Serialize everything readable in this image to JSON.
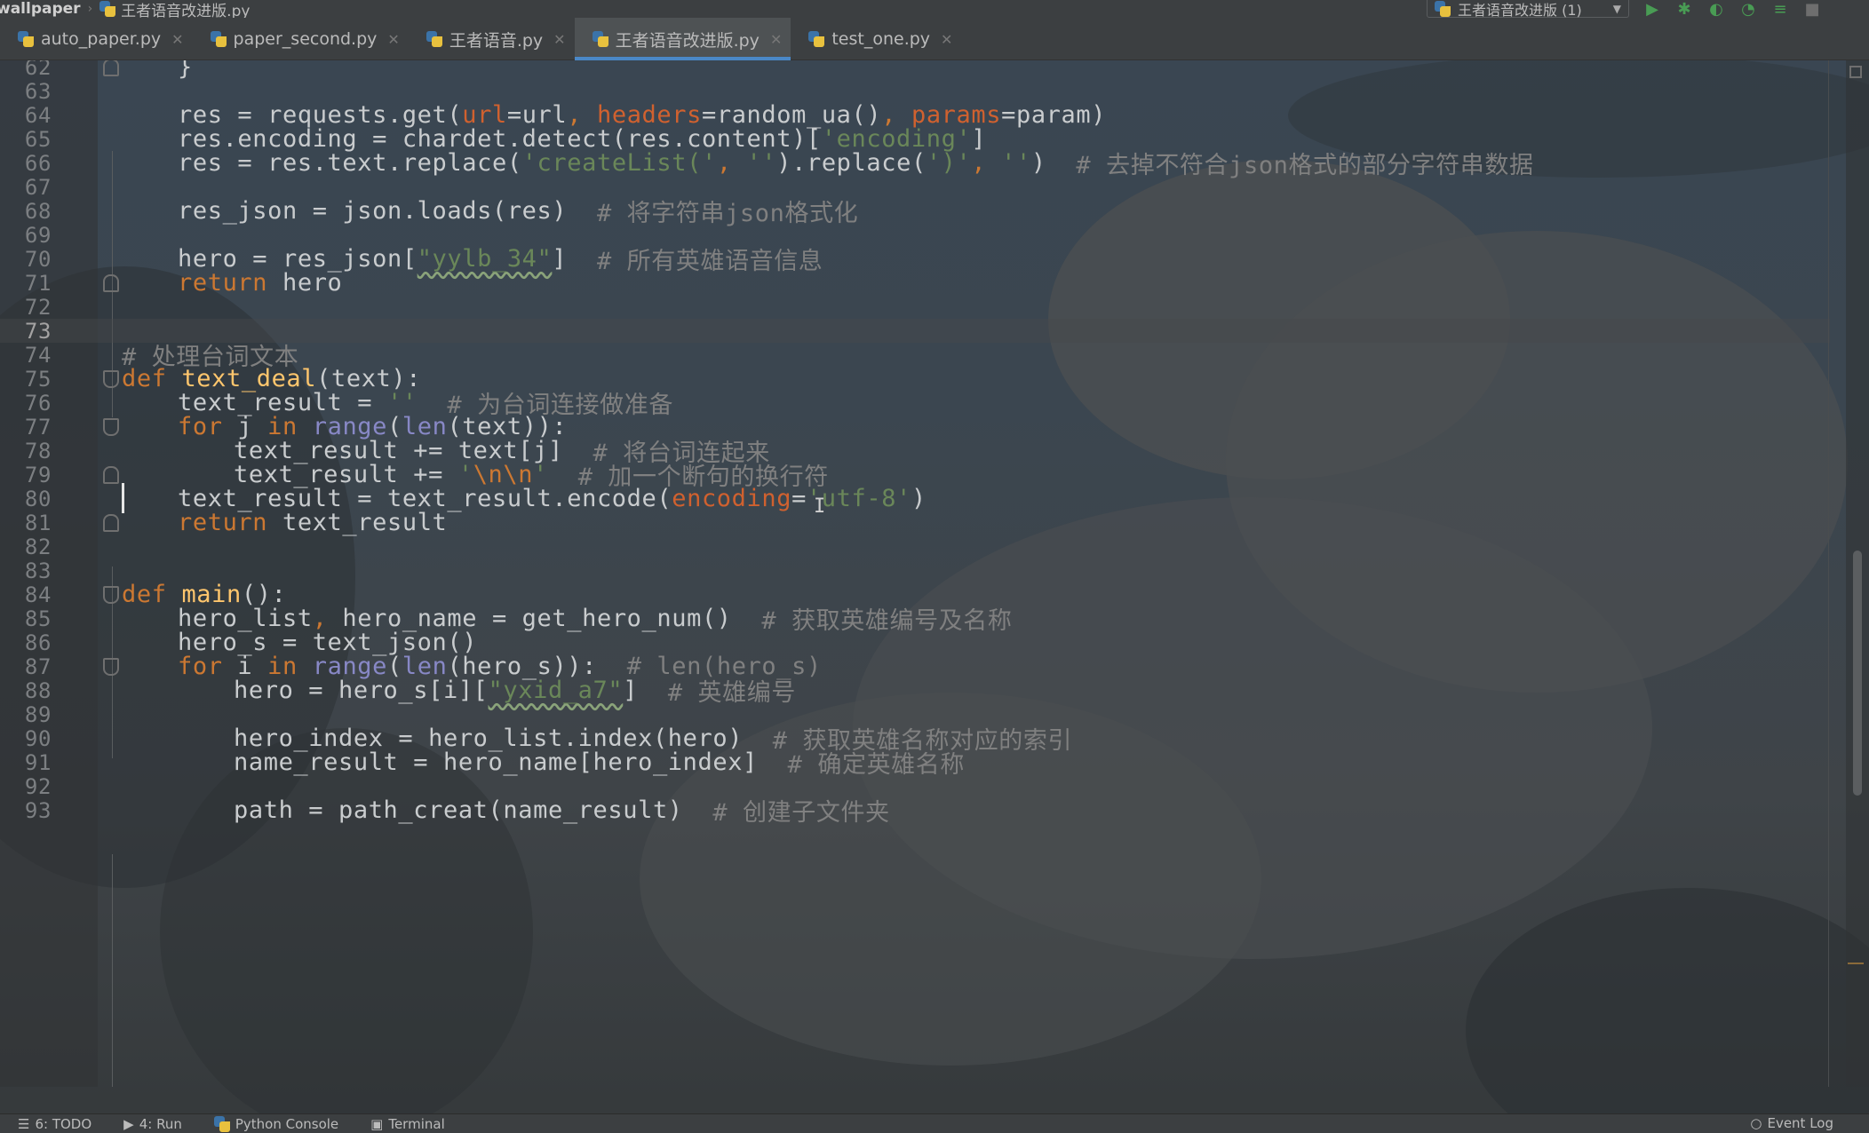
{
  "navbar": {
    "project": "wallpaper",
    "file": "王者语音改进版.py"
  },
  "run_config": {
    "label": "王者语音改进版 (1)"
  },
  "tabs": [
    {
      "label": "auto_paper.py",
      "active": false
    },
    {
      "label": "paper_second.py",
      "active": false
    },
    {
      "label": "王者语音.py",
      "active": false
    },
    {
      "label": "王者语音改进版.py",
      "active": true
    },
    {
      "label": "test_one.py",
      "active": false
    }
  ],
  "editor": {
    "current_line": "73",
    "lines": [
      {
        "n": "62",
        "t": [
          "}"
        ]
      },
      {
        "n": "63",
        "t": [
          ""
        ]
      },
      {
        "n": "64",
        "t": [
          "res = requests.get(",
          "url",
          "=url",
          ", ",
          "headers",
          "=random_ua()",
          ", ",
          "params",
          "=param)"
        ]
      },
      {
        "n": "65",
        "t": [
          "res.encoding = chardet.detect(res.content)[",
          "'encoding'",
          "]"
        ]
      },
      {
        "n": "66",
        "t": [
          "res = res.text.replace(",
          "'createList('",
          ", ",
          "''",
          ").replace(",
          "')'",
          ", ",
          "''",
          ")  ",
          "# 去掉不符合json格式的部分字符串数据"
        ]
      },
      {
        "n": "67",
        "t": [
          ""
        ]
      },
      {
        "n": "68",
        "t": [
          "res_json = json.loads(res)  ",
          "# 将字符串json格式化"
        ]
      },
      {
        "n": "69",
        "t": [
          ""
        ]
      },
      {
        "n": "70",
        "t": [
          "hero = res_json[",
          "\"yylb_34\"",
          "]  ",
          "# 所有英雄语音信息"
        ]
      },
      {
        "n": "71",
        "t": [
          "return",
          " hero"
        ]
      },
      {
        "n": "72",
        "t": [
          ""
        ]
      },
      {
        "n": "73",
        "t": [
          ""
        ]
      },
      {
        "n": "74",
        "t": [
          "# 处理台词文本"
        ]
      },
      {
        "n": "75",
        "t": [
          "def",
          " ",
          "text_deal",
          "(text):"
        ]
      },
      {
        "n": "76",
        "t": [
          "text_result = ",
          "''",
          "  ",
          "# 为台词连接做准备"
        ]
      },
      {
        "n": "77",
        "t": [
          "for",
          " j ",
          "in",
          " ",
          "range",
          "(",
          "len",
          "(text)):"
        ]
      },
      {
        "n": "78",
        "t": [
          "text_result += text[j]  ",
          "# 将台词连起来"
        ]
      },
      {
        "n": "79",
        "t": [
          "text_result += ",
          "'",
          "\\n\\n",
          "'",
          "  ",
          "# 加一个断句的换行符"
        ]
      },
      {
        "n": "80",
        "t": [
          "text_result = text_result.encode(",
          "encoding",
          "=",
          "'utf-8'",
          ")"
        ]
      },
      {
        "n": "81",
        "t": [
          "return",
          " text_result"
        ]
      },
      {
        "n": "82",
        "t": [
          ""
        ]
      },
      {
        "n": "83",
        "t": [
          ""
        ]
      },
      {
        "n": "84",
        "t": [
          "def",
          " ",
          "main",
          "():"
        ]
      },
      {
        "n": "85",
        "t": [
          "hero_list",
          ", ",
          "hero_name = get_hero_num()  ",
          "# 获取英雄编号及名称"
        ]
      },
      {
        "n": "86",
        "t": [
          "hero_s = text_json()"
        ]
      },
      {
        "n": "87",
        "t": [
          "for",
          " i ",
          "in",
          " ",
          "range",
          "(",
          "len",
          "(hero_s)):  ",
          "# len(hero_s)"
        ]
      },
      {
        "n": "88",
        "t": [
          "hero = hero_s[i][",
          "\"yxid_a7\"",
          "]  ",
          "# 英雄编号"
        ]
      },
      {
        "n": "89",
        "t": [
          ""
        ]
      },
      {
        "n": "90",
        "t": [
          "hero_index = hero_list.index(hero)  ",
          "# 获取英雄名称对应的索引"
        ]
      },
      {
        "n": "91",
        "t": [
          "name_result = hero_name[hero_index]  ",
          "# 确定英雄名称"
        ]
      },
      {
        "n": "92",
        "t": [
          ""
        ]
      },
      {
        "n": "93",
        "t": [
          "path = path_creat(name_result)  ",
          "# 创建子文件夹"
        ]
      }
    ]
  },
  "statusbar": {
    "todo": "6: TODO",
    "run": "4: Run",
    "console": "Python Console",
    "terminal": "Terminal",
    "event_log": "Event Log"
  },
  "colors": {
    "keyword": "#cc7832",
    "function": "#ffc66d",
    "string": "#6a8759",
    "comment": "#808080",
    "param": "#d0612f",
    "builtin": "#8888c6",
    "accent": "#4a88c7"
  }
}
